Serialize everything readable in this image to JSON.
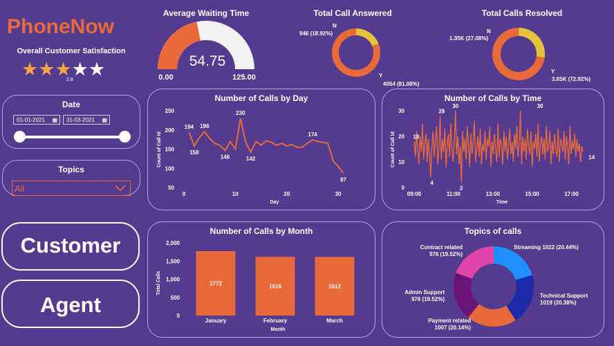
{
  "brand": {
    "name": "PhoneNow",
    "color": "#e8693a"
  },
  "satisfaction": {
    "label": "Overall Customer Satisfaction",
    "rating": 2.8,
    "rating_text": "2.8",
    "max": 5
  },
  "date_filter": {
    "label": "Date",
    "start": "01-01-2021",
    "end": "31-03-2021"
  },
  "topics_filter": {
    "label": "Topics",
    "value": "All"
  },
  "buttons": {
    "customer": "Customer",
    "agent": "Agent"
  },
  "colors": {
    "background": "#553b8f",
    "orange": "#e8693a",
    "yellow": "#e3c33a"
  },
  "chart_data": [
    {
      "type": "gauge",
      "title": "Average Waiting Time",
      "value": 54.75,
      "value_text": "54.75",
      "min": 0,
      "max": 125,
      "min_text": "0.00",
      "max_text": "125.00"
    },
    {
      "type": "donut",
      "title": "Total Call Answered",
      "slices": [
        {
          "label": "Y",
          "value": 4054,
          "value_text": "4054 (81.08%)",
          "color": "#e8693a"
        },
        {
          "label": "N",
          "value": 946,
          "value_text": "946 (18.92%)",
          "color": "#e3c33a"
        }
      ]
    },
    {
      "type": "donut",
      "title": "Total Calls Resolved",
      "slices": [
        {
          "label": "Y",
          "value": 3650,
          "value_text": "3.65K (72.92%)",
          "color": "#e8693a"
        },
        {
          "label": "N",
          "value": 1350,
          "value_text": "1.35K (27.08%)",
          "color": "#e3c33a"
        }
      ]
    },
    {
      "type": "line",
      "title": "Number of Calls by Day",
      "xlabel": "Day",
      "ylabel": "Count of Call Id",
      "xlim": [
        0,
        32
      ],
      "ylim": [
        50,
        250
      ],
      "xticks": [
        0,
        10,
        20,
        30
      ],
      "yticks": [
        50,
        100,
        150,
        200,
        250
      ],
      "x": [
        1,
        2,
        3,
        4,
        5,
        6,
        7,
        8,
        9,
        10,
        11,
        12,
        13,
        14,
        15,
        16,
        17,
        18,
        19,
        20,
        21,
        22,
        23,
        24,
        25,
        26,
        27,
        28,
        29,
        30,
        31
      ],
      "values": [
        194,
        158,
        180,
        196,
        178,
        165,
        160,
        146,
        170,
        150,
        230,
        168,
        142,
        170,
        160,
        172,
        168,
        160,
        165,
        158,
        162,
        155,
        155,
        165,
        174,
        170,
        168,
        165,
        120,
        105,
        87
      ],
      "data_labels": [
        {
          "x": 1,
          "y": 194,
          "text": "194"
        },
        {
          "x": 2,
          "y": 158,
          "text": "158"
        },
        {
          "x": 4,
          "y": 196,
          "text": "196"
        },
        {
          "x": 8,
          "y": 146,
          "text": "146"
        },
        {
          "x": 11,
          "y": 230,
          "text": "230"
        },
        {
          "x": 13,
          "y": 142,
          "text": "142"
        },
        {
          "x": 25,
          "y": 174,
          "text": "174"
        },
        {
          "x": 31,
          "y": 87,
          "text": "87"
        }
      ]
    },
    {
      "type": "line",
      "title": "Number of Calls by Time",
      "xlabel": "Time",
      "ylabel": "Count of Call Id",
      "xlim": [
        0,
        9
      ],
      "ylim": [
        0,
        30
      ],
      "xticks": [
        "09:00",
        "11:00",
        "13:00",
        "15:00",
        "17:00"
      ],
      "yticks": [
        0,
        10,
        20,
        30
      ],
      "x_hours_from_9": [
        0,
        0.06,
        0.12,
        0.18,
        0.24,
        0.3,
        0.36,
        0.42,
        0.48,
        0.54,
        0.6,
        0.66,
        0.72,
        0.78,
        0.84,
        0.9,
        0.96,
        1.02,
        1.08,
        1.14,
        1.2,
        1.26,
        1.32,
        1.38,
        1.44,
        1.5,
        1.56,
        1.62,
        1.68,
        1.74,
        1.8,
        1.86,
        1.92,
        1.98,
        2.04,
        2.1,
        2.16,
        2.22,
        2.28,
        2.34,
        2.4,
        2.46,
        2.52,
        2.58,
        2.64,
        2.7,
        2.76,
        2.82,
        2.88,
        2.94,
        3.0,
        3.06,
        3.12,
        3.18,
        3.24,
        3.3,
        3.36,
        3.42,
        3.48,
        3.54,
        3.6,
        3.66,
        3.72,
        3.78,
        3.84,
        3.9,
        3.96,
        4.02,
        4.08,
        4.14,
        4.2,
        4.26,
        4.32,
        4.38,
        4.44,
        4.5,
        4.56,
        4.62,
        4.68,
        4.74,
        4.8,
        4.86,
        4.92,
        4.98,
        5.04,
        5.1,
        5.16,
        5.22,
        5.28,
        5.34,
        5.4,
        5.46,
        5.52,
        5.58,
        5.64,
        5.7,
        5.76,
        5.82,
        5.88,
        5.94,
        6.0,
        6.06,
        6.12,
        6.18,
        6.24,
        6.3,
        6.36,
        6.42,
        6.48,
        6.54,
        6.6,
        6.66,
        6.72,
        6.78,
        6.84,
        6.9,
        6.96,
        7.02,
        7.08,
        7.14,
        7.2,
        7.26,
        7.32,
        7.38,
        7.44,
        7.5,
        7.56,
        7.62,
        7.68,
        7.74,
        7.8,
        7.86,
        7.92,
        7.98,
        8.04,
        8.1,
        8.16,
        8.22,
        8.28,
        8.34,
        8.4,
        8.46,
        8.52,
        8.58,
        8.64,
        8.7,
        8.76,
        8.82,
        8.88
      ],
      "values": [
        18,
        12,
        22,
        15,
        9,
        20,
        14,
        25,
        11,
        17,
        21,
        10,
        19,
        13,
        4,
        16,
        22,
        12,
        18,
        24,
        9,
        15,
        28,
        11,
        19,
        14,
        23,
        8,
        17,
        21,
        12,
        25,
        15,
        10,
        18,
        30,
        13,
        20,
        9,
        16,
        2,
        22,
        14,
        19,
        11,
        24,
        17,
        8,
        21,
        13,
        18,
        26,
        10,
        15,
        20,
        12,
        23,
        9,
        17,
        14,
        22,
        11,
        19,
        16,
        24,
        8,
        18,
        13,
        21,
        15,
        10,
        25,
        12,
        19,
        17,
        9,
        22,
        14,
        20,
        11,
        16,
        23,
        13,
        18,
        10,
        21,
        15,
        24,
        12,
        17,
        30,
        9,
        20,
        14,
        19,
        11,
        23,
        16,
        13,
        22,
        8,
        18,
        15,
        21,
        12,
        25,
        10,
        17,
        20,
        13,
        19,
        11,
        24,
        14,
        16,
        22,
        9,
        18,
        13,
        21,
        15,
        12,
        23,
        10,
        19,
        17,
        14,
        22,
        11,
        20,
        16,
        9,
        24,
        13,
        18,
        15,
        21,
        12,
        19,
        14,
        17,
        10,
        16,
        14
      ],
      "data_labels": [
        {
          "x": 0.1,
          "y": 18,
          "text": "18"
        },
        {
          "x": 0.9,
          "y": 4,
          "text": "4"
        },
        {
          "x": 1.4,
          "y": 28,
          "text": "28"
        },
        {
          "x": 2.1,
          "y": 30,
          "text": "30"
        },
        {
          "x": 2.4,
          "y": 2,
          "text": "2"
        },
        {
          "x": 6.4,
          "y": 30,
          "text": "30"
        },
        {
          "x": 8.88,
          "y": 14,
          "text": "14"
        }
      ]
    },
    {
      "type": "bar",
      "title": "Number of Calls by Month",
      "xlabel": "Month",
      "ylabel": "Total Calls",
      "categories": [
        "January",
        "February",
        "March"
      ],
      "values": [
        1772,
        1616,
        1612
      ],
      "ylim": [
        0,
        2000
      ],
      "yticks": [
        "0",
        "500",
        "1,000",
        "1,500",
        "2,000"
      ]
    },
    {
      "type": "donut",
      "title": "Topics of calls",
      "slices": [
        {
          "label": "Streaming",
          "value": 1022,
          "value_text": "Streaming 1022 (20.44%)",
          "color": "#1f8fff"
        },
        {
          "label": "Technical Support",
          "value": 1019,
          "value_text": "Technical Support\n1019 (20.38%)",
          "color": "#1a2aa8"
        },
        {
          "label": "Payment related",
          "value": 1007,
          "value_text": "Payment related\n1007 (20.14%)",
          "color": "#e8693a"
        },
        {
          "label": "Admin Support",
          "value": 976,
          "value_text": "Admin Support\n976 (19.52%)",
          "color": "#6b1478"
        },
        {
          "label": "Contract related",
          "value": 976,
          "value_text": "Contract related\n976 (19.52%)",
          "color": "#e044a8"
        }
      ]
    }
  ]
}
